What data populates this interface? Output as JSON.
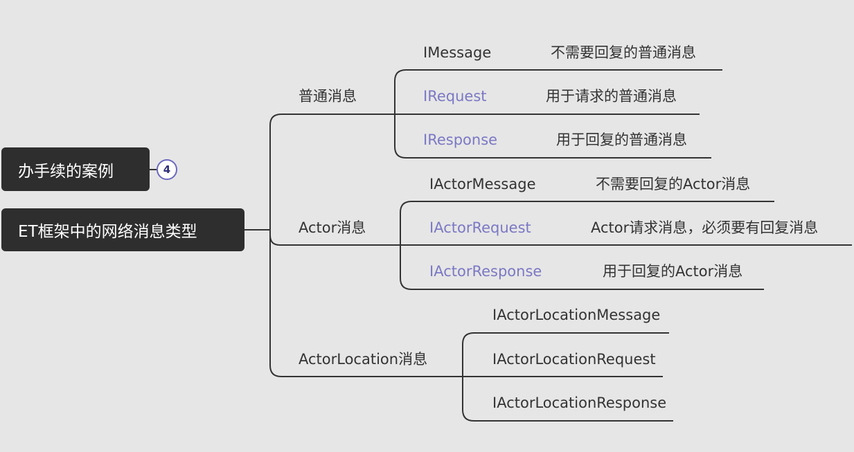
{
  "colors": {
    "background": "#e6e6e6",
    "node": "#2e2e2e",
    "line": "#333333",
    "highlight": "#7b78c4"
  },
  "left_nodes": {
    "case_node": "办手续的案例",
    "case_badge": "4",
    "root_node": "ET框架中的网络消息类型"
  },
  "branches": [
    {
      "label": "普通消息",
      "children": [
        {
          "name": "IMessage",
          "desc": "不需要回复的普通消息"
        },
        {
          "name": "IRequest",
          "desc": "用于请求的普通消息"
        },
        {
          "name": "IResponse",
          "desc": "用于回复的普通消息"
        }
      ]
    },
    {
      "label": "Actor消息",
      "children": [
        {
          "name": "IActorMessage",
          "desc": "不需要回复的Actor消息"
        },
        {
          "name": "IActorRequest",
          "desc": "Actor请求消息，必须要有回复消息"
        },
        {
          "name": "IActorResponse",
          "desc": "用于回复的Actor消息"
        }
      ]
    },
    {
      "label": "ActorLocation消息",
      "children": [
        {
          "name": "IActorLocationMessage"
        },
        {
          "name": "IActorLocationRequest"
        },
        {
          "name": "IActorLocationResponse"
        }
      ]
    }
  ]
}
